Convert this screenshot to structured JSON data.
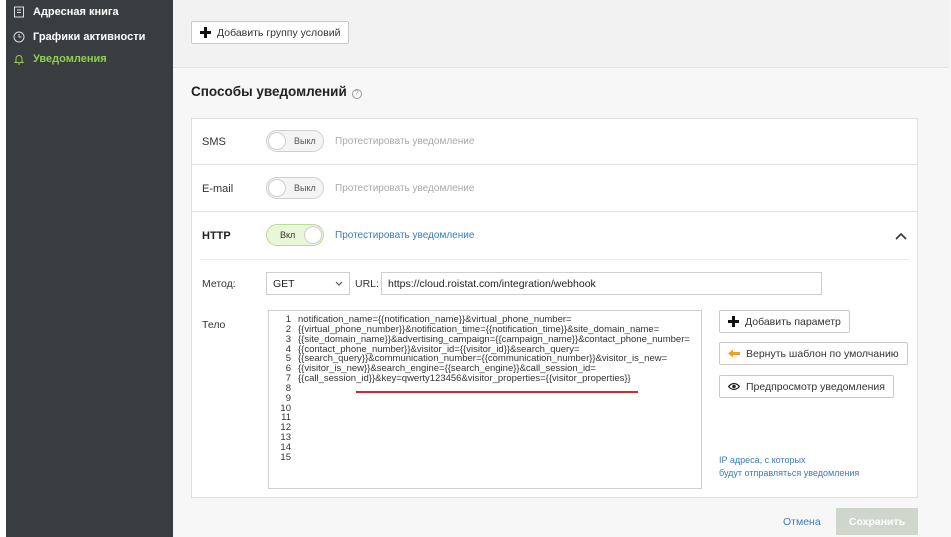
{
  "sidebar": {
    "items": [
      {
        "label": "Адресная книга",
        "icon": "address-book-icon"
      },
      {
        "label": "Графики активности",
        "icon": "clock-icon"
      },
      {
        "label": "Уведомления",
        "icon": "bell-icon",
        "active": true
      }
    ]
  },
  "conditions": {
    "add_group_label": "Добавить группу условий"
  },
  "section": {
    "title": "Способы уведомлений"
  },
  "methods": [
    {
      "label": "SMS",
      "toggle": "Выкл",
      "enabled": false,
      "test_label": "Протестировать уведомление"
    },
    {
      "label": "E-mail",
      "toggle": "Выкл",
      "enabled": false,
      "test_label": "Протестировать уведомление"
    },
    {
      "label": "HTTP",
      "toggle": "Вкл",
      "enabled": true,
      "test_label": "Протестировать уведомление"
    }
  ],
  "http": {
    "method_label": "Метод:",
    "method_value": "GET",
    "url_label": "URL:",
    "url_value": "https://cloud.roistat.com/integration/webhook",
    "body_label": "Тело",
    "line_numbers": "1\n2\n3\n4\n5\n6\n7\n8\n9\n10\n11\n12\n13\n14\n15",
    "body_code": "notification_name={{notification_name}}&virtual_phone_number=\n{{virtual_phone_number}}&notification_time={{notification_time}}&site_domain_name=\n{{site_domain_name}}&advertising_campaign={{campaign_name}}&contact_phone_number=\n{{contact_phone_number}}&visitor_id={{visitor_id}}&search_query=\n{{search_query}}&communication_number={{communication_number}}&visitor_is_new=\n{{visitor_is_new}}&search_engine={{search_engine}}&call_session_id=\n{{call_session_id}}&key=qwerty123456&visitor_properties={{visitor_properties}}",
    "add_param_label": "Добавить параметр",
    "reset_template_label": "Вернуть шаблон по умолчанию",
    "preview_label": "Предпросмотр уведомления",
    "ip_note_line1": "IP адреса, с которых",
    "ip_note_line2": "будут отправляться уведомления"
  },
  "footer": {
    "cancel_label": "Отмена",
    "save_label": "Сохранить"
  },
  "colors": {
    "sidebar_bg": "#3a3d3f",
    "active_green": "#8fd14f",
    "link_blue": "#3a7bbf",
    "underline_red": "#d9262c"
  }
}
